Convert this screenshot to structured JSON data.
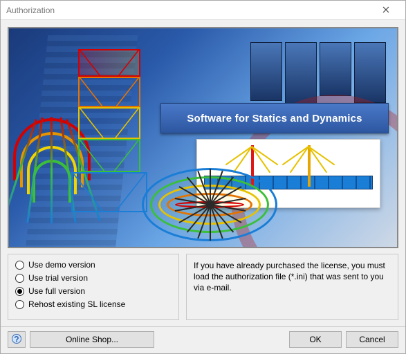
{
  "window": {
    "title": "Authorization"
  },
  "banner": {
    "slogan": "Software for Statics and Dynamics"
  },
  "options": {
    "items": [
      {
        "label": "Use demo version",
        "checked": false
      },
      {
        "label": "Use trial version",
        "checked": false
      },
      {
        "label": "Use full version",
        "checked": true
      },
      {
        "label": "Rehost existing SL license",
        "checked": false
      }
    ]
  },
  "info": {
    "text": "If you have already purchased the license, you must load the authorization file (*.ini) that was sent to you via e-mail."
  },
  "footer": {
    "online_shop": "Online Shop...",
    "ok": "OK",
    "cancel": "Cancel"
  }
}
